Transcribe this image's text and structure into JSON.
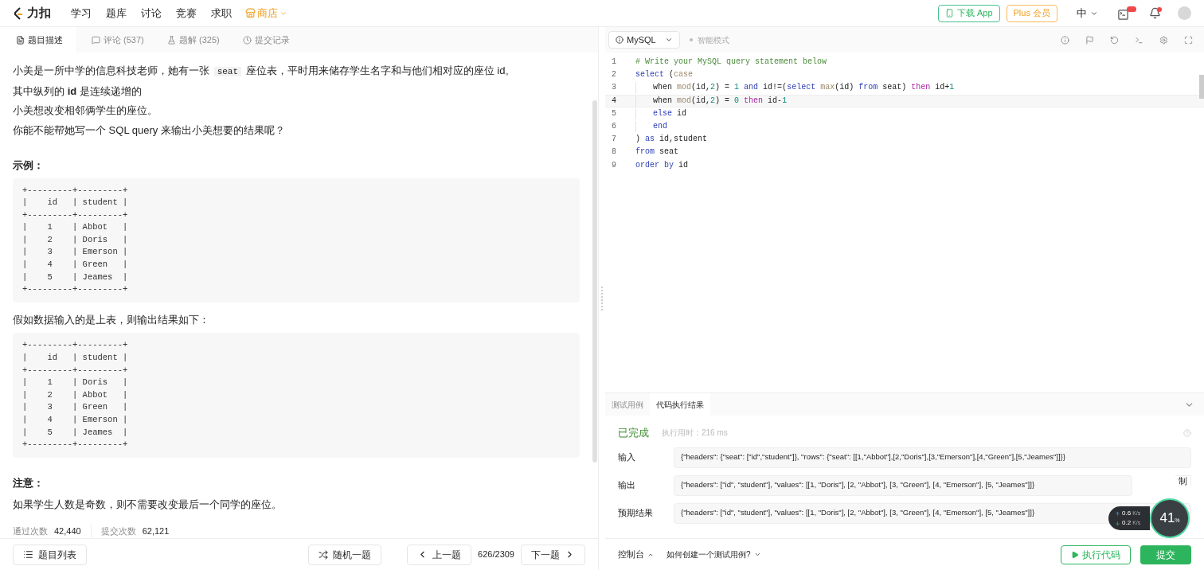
{
  "nav": {
    "logo": "力扣",
    "links": [
      {
        "label": "学习",
        "selected": false
      },
      {
        "label": "题库",
        "selected": false
      },
      {
        "label": "讨论",
        "selected": false
      },
      {
        "label": "竞赛",
        "selected": false
      },
      {
        "label": "求职",
        "selected": false
      }
    ],
    "shop": "商店",
    "download": "下载 App",
    "plus": "Plus 会员",
    "lang": "中"
  },
  "left_tabs": [
    {
      "label": "题目描述",
      "kind": "desc",
      "selected": true
    },
    {
      "label": "评论 (537)",
      "kind": "comment",
      "selected": false
    },
    {
      "label": "题解 (325)",
      "kind": "flask",
      "selected": false
    },
    {
      "label": "提交记录",
      "kind": "clock",
      "selected": false
    }
  ],
  "description": [
    {
      "kind": "parts",
      "parts": [
        {
          "text": "小美是一所中学的信息科技老师，她有一张 ",
          "kind": "text"
        },
        {
          "text": "seat",
          "kind": "code"
        },
        {
          "text": " 座位表，平时用来储存学生名字和与他们相对应的座位 id。",
          "kind": "text"
        }
      ]
    },
    {
      "kind": "text",
      "text": "其中纵列的 **id** 是连续递增的"
    },
    {
      "kind": "text",
      "text": "小美想改变相邻俩学生的座位。"
    },
    {
      "kind": "text",
      "text": "你能不能帮她写一个 SQL query 来输出小美想要的结果呢？"
    },
    {
      "kind": "heading",
      "text": "示例："
    },
    {
      "kind": "pre",
      "lines": [
        "+---------+---------+",
        "|    id   | student |",
        "+---------+---------+",
        "|    1    | Abbot   |",
        "|    2    | Doris   |",
        "|    3    | Emerson |",
        "|    4    | Green   |",
        "|    5    | Jeames  |",
        "+---------+---------+"
      ]
    },
    {
      "kind": "text",
      "text": "假如数据输入的是上表，则输出结果如下："
    },
    {
      "kind": "pre",
      "lines": [
        "+---------+---------+",
        "|    id   | student |",
        "+---------+---------+",
        "|    1    | Doris   |",
        "|    2    | Abbot   |",
        "|    3    | Green   |",
        "|    4    | Emerson |",
        "|    5    | Jeames  |",
        "+---------+---------+"
      ]
    },
    {
      "kind": "heading",
      "text": "注意："
    },
    {
      "kind": "text",
      "text": "如果学生人数是奇数，则不需要改变最后一个同学的座位。"
    }
  ],
  "stats": [
    {
      "label": "通过次数",
      "value": "42,440"
    },
    {
      "label": "提交次数",
      "value": "62,121"
    }
  ],
  "left_footer": {
    "list": "题目列表",
    "random": "随机一题",
    "prev": "上一题",
    "page": "626/2309",
    "next": "下一题"
  },
  "editor_toolbar": {
    "language": "MySQL",
    "mode": "智能模式"
  },
  "code": [
    {
      "n": "1",
      "current": false,
      "indented": false,
      "tokens": [
        {
          "text": "# Write your MySQL query statement below",
          "kind": "comment"
        }
      ]
    },
    {
      "n": "2",
      "current": false,
      "indented": false,
      "tokens": [
        {
          "text": "select",
          "kind": "keyword"
        },
        {
          "text": " (",
          "kind": "plain"
        },
        {
          "text": "case",
          "kind": "function"
        }
      ]
    },
    {
      "n": "3",
      "current": false,
      "indented": true,
      "tokens": [
        {
          "text": "when ",
          "kind": "plain"
        },
        {
          "text": "mod",
          "kind": "function"
        },
        {
          "text": "(id,",
          "kind": "plain"
        },
        {
          "text": "2",
          "kind": "number"
        },
        {
          "text": ") = ",
          "kind": "plain"
        },
        {
          "text": "1",
          "kind": "number"
        },
        {
          "text": " and",
          "kind": "keyword"
        },
        {
          "text": " id!=(",
          "kind": "plain"
        },
        {
          "text": "select",
          "kind": "keyword"
        },
        {
          "text": " max",
          "kind": "function"
        },
        {
          "text": "(id) ",
          "kind": "plain"
        },
        {
          "text": "from",
          "kind": "keyword"
        },
        {
          "text": " seat) ",
          "kind": "plain"
        },
        {
          "text": "then",
          "kind": "control"
        },
        {
          "text": " id+",
          "kind": "plain"
        },
        {
          "text": "1",
          "kind": "number"
        }
      ]
    },
    {
      "n": "4",
      "current": true,
      "indented": true,
      "tokens": [
        {
          "text": "when ",
          "kind": "plain"
        },
        {
          "text": "mod",
          "kind": "function"
        },
        {
          "text": "(id,",
          "kind": "plain"
        },
        {
          "text": "2",
          "kind": "number"
        },
        {
          "text": ") = ",
          "kind": "plain"
        },
        {
          "text": "0",
          "kind": "number"
        },
        {
          "text": " then",
          "kind": "control"
        },
        {
          "text": " id-",
          "kind": "plain"
        },
        {
          "text": "1",
          "kind": "number"
        }
      ]
    },
    {
      "n": "5",
      "current": false,
      "indented": true,
      "tokens": [
        {
          "text": "else",
          "kind": "keyword"
        },
        {
          "text": " id",
          "kind": "plain"
        }
      ]
    },
    {
      "n": "6",
      "current": false,
      "indented": true,
      "tokens": [
        {
          "text": "end",
          "kind": "keyword"
        }
      ]
    },
    {
      "n": "7",
      "current": false,
      "indented": false,
      "tokens": [
        {
          "text": ") ",
          "kind": "plain"
        },
        {
          "text": "as",
          "kind": "keyword"
        },
        {
          "text": " id,student",
          "kind": "plain"
        }
      ]
    },
    {
      "n": "8",
      "current": false,
      "indented": false,
      "tokens": [
        {
          "text": "from",
          "kind": "keyword"
        },
        {
          "text": " seat",
          "kind": "plain"
        }
      ]
    },
    {
      "n": "9",
      "current": false,
      "indented": false,
      "tokens": [
        {
          "text": "order by",
          "kind": "keyword"
        },
        {
          "text": " id",
          "kind": "plain"
        }
      ]
    }
  ],
  "result_tabs": [
    {
      "label": "测试用例",
      "selected": false
    },
    {
      "label": "代码执行结果",
      "selected": true
    }
  ],
  "result": {
    "status": "已完成",
    "runtime": "执行用时：216 ms",
    "rows": [
      {
        "label": "输入",
        "value": "{\"headers\": {\"seat\": [\"id\",\"student\"]}, \"rows\": {\"seat\": [[1,\"Abbot\"],[2,\"Doris\"],[3,\"Emerson\"],[4,\"Green\"],[5,\"Jeames\"]]}}"
      },
      {
        "label": "输出",
        "value": "{\"headers\": [\"id\", \"student\"], \"values\": [[1, \"Doris\"], [2, \"Abbot\"], [3, \"Green\"], [4, \"Emerson\"], [5, \"Jeames\"]]}"
      },
      {
        "label": "预期结果",
        "value": "{\"headers\": [\"id\", \"student\"], \"values\": [[1, \"Doris\"], [2, \"Abbot\"], [3, \"Green\"], [4, \"Emerson\"], [5, \"Jeames\"]]}"
      }
    ],
    "copy": "制"
  },
  "right_footer": {
    "console": "控制台",
    "howto": "如何创建一个测试用例?",
    "run": "执行代码",
    "submit": "提交"
  },
  "net_widget": {
    "up": "0.6",
    "up_unit": "K/s",
    "down": "0.2",
    "down_unit": "K/s",
    "percent": "41",
    "percent_unit": "%"
  }
}
